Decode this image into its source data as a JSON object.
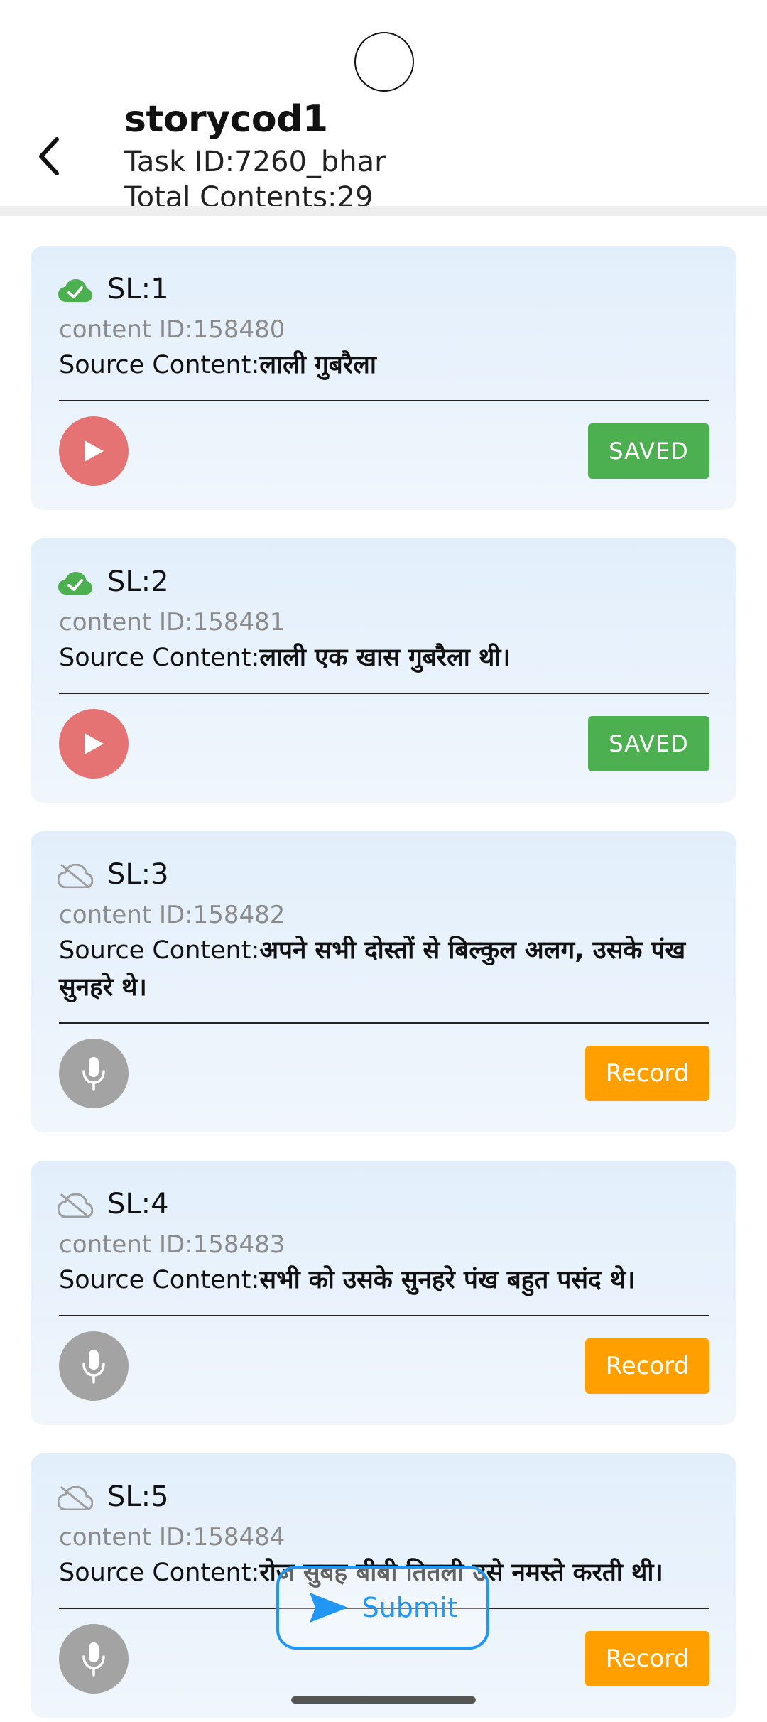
{
  "header": {
    "title": "storycod1",
    "task_id": "Task ID:7260_bhar",
    "total_contents": "Total Contents:29"
  },
  "cards": [
    {
      "sl": "SL:1",
      "content_id": "content ID:158480",
      "source_label": "Source Content:",
      "source_text": "लाली गुबरैला",
      "status": "saved",
      "action_label": "SAVED"
    },
    {
      "sl": "SL:2",
      "content_id": "content ID:158481",
      "source_label": "Source Content:",
      "source_text": "लाली एक खास गुबरैला थी।",
      "status": "saved",
      "action_label": "SAVED"
    },
    {
      "sl": "SL:3",
      "content_id": "content ID:158482",
      "source_label": "Source Content:",
      "source_text": "अपने सभी दोस्तों से बिल्कुल अलग, उसके पंख सुनहरे थे।",
      "status": "not_saved",
      "action_label": "Record"
    },
    {
      "sl": "SL:4",
      "content_id": "content ID:158483",
      "source_label": "Source Content:",
      "source_text": "सभी को उसके सुनहरे पंख बहुत पसंद थे।",
      "status": "not_saved",
      "action_label": "Record"
    },
    {
      "sl": "SL:5",
      "content_id": "content ID:158484",
      "source_label": "Source Content:",
      "source_text": "रोज सुबह बीबी तितली उसे नमस्ते करती थी।",
      "status": "not_saved",
      "action_label": "Record"
    }
  ],
  "submit": {
    "label": "Submit"
  },
  "colors": {
    "saved": "#4caf50",
    "record": "#ffa000",
    "play": "#e57373",
    "mic": "#a3a3a3",
    "submit": "#2196f3",
    "card_bg": "#e2effb"
  }
}
